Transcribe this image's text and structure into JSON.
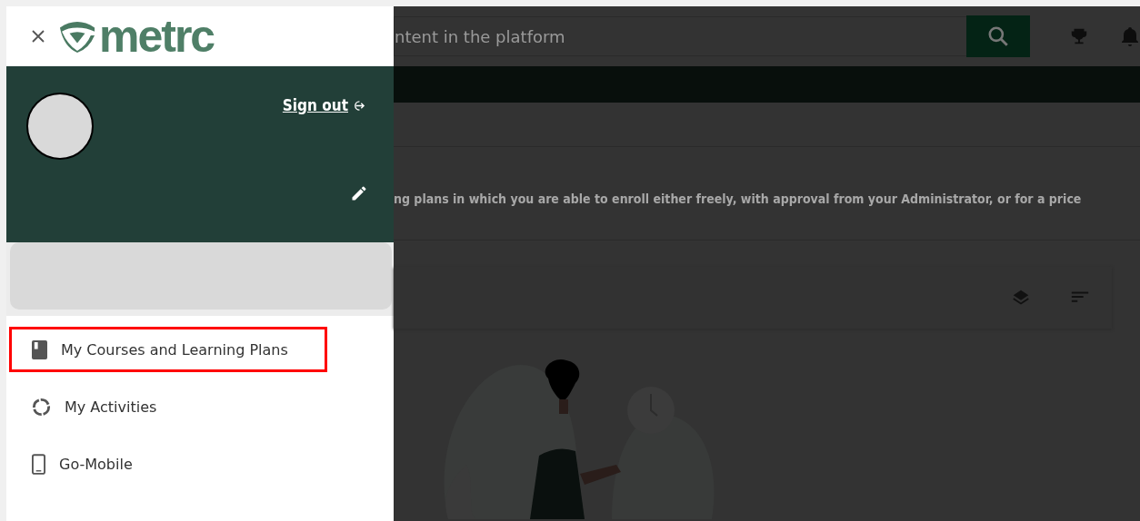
{
  "drawer": {
    "logo": "metrc",
    "sign_out": "Sign out",
    "menu": [
      {
        "label": "My Courses and Learning Plans",
        "kind": "book",
        "highlighted": true
      },
      {
        "label": "My Activities",
        "kind": "activity",
        "highlighted": false
      },
      {
        "label": "Go-Mobile",
        "kind": "mobile",
        "highlighted": false
      }
    ]
  },
  "page": {
    "search": {
      "placeholder": "ntent in the platform"
    },
    "description": "ng plans in which you are able to enroll either freely, with approval from your Administrator, or for a price"
  }
}
